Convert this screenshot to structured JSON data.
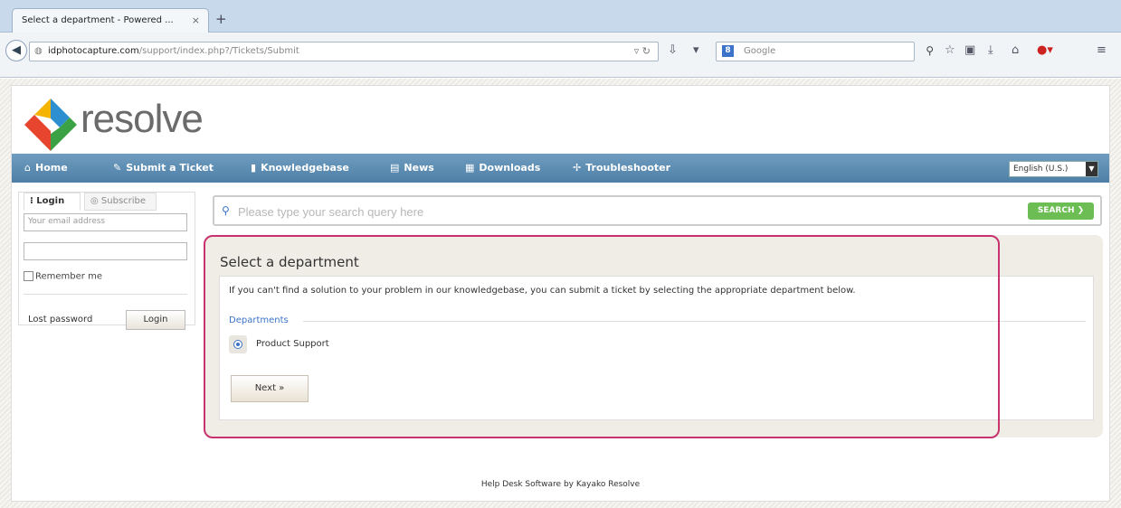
{
  "browser": {
    "tab_title": "Select a department - Powered ...",
    "tab_close": "×",
    "new_tab": "+",
    "url_host": "idphotocapture.com",
    "url_path": "/support/index.php?/Tickets/Submit",
    "search_engine": "Google"
  },
  "site": {
    "logo_text": "resolve",
    "menu": [
      {
        "label": "Home",
        "icon": "home-icon"
      },
      {
        "label": "Submit a Ticket",
        "icon": "pencil-icon"
      },
      {
        "label": "Knowledgebase",
        "icon": "book-icon"
      },
      {
        "label": "News",
        "icon": "news-icon"
      },
      {
        "label": "Downloads",
        "icon": "download-icon"
      },
      {
        "label": "Troubleshooter",
        "icon": "puzzle-icon"
      }
    ],
    "language": "English (U.S.)"
  },
  "sidebar": {
    "tab_login": "Login",
    "tab_subscribe": "Subscribe",
    "email_placeholder": "Your email address",
    "remember_me": "Remember me",
    "lost_password": "Lost password",
    "login_button": "Login"
  },
  "search": {
    "placeholder": "Please type your search query here",
    "button": "SEARCH"
  },
  "main": {
    "title": "Select a department",
    "description": "If you can't find a solution to your problem in our knowledgebase, you can submit a ticket by selecting the appropriate department below.",
    "departments_legend": "Departments",
    "department_option": "Product Support",
    "next_button": "Next »"
  },
  "footer": "Help Desk Software by Kayako Resolve",
  "colors": {
    "menu_bar": "#5a8ab0",
    "search_button": "#6cbd54",
    "highlight_border": "#c8336f"
  }
}
